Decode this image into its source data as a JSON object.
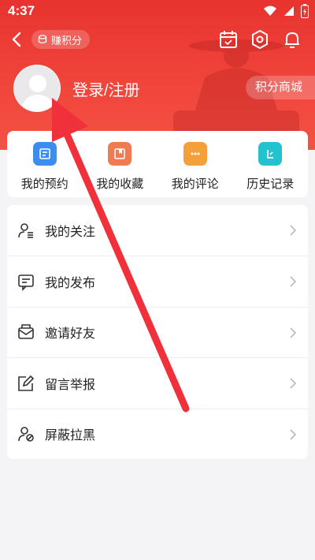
{
  "status": {
    "time": "4:37"
  },
  "nav": {
    "earn_points_label": "赚积分"
  },
  "profile": {
    "login_label": "登录/注册",
    "points_mall_label": "积分商城"
  },
  "quick_actions": [
    {
      "label": "我的预约",
      "icon": "appointment-icon",
      "color": "#3c8df0"
    },
    {
      "label": "我的收藏",
      "icon": "favorites-icon",
      "color": "#f07b52"
    },
    {
      "label": "我的评论",
      "icon": "comments-icon",
      "color": "#f4a03a"
    },
    {
      "label": "历史记录",
      "icon": "history-icon",
      "color": "#23c2cf"
    }
  ],
  "menu": [
    {
      "label": "我的关注",
      "icon": "following-icon"
    },
    {
      "label": "我的发布",
      "icon": "posts-icon"
    },
    {
      "label": "邀请好友",
      "icon": "invite-icon"
    },
    {
      "label": "留言举报",
      "icon": "report-icon"
    },
    {
      "label": "屏蔽拉黑",
      "icon": "block-icon"
    }
  ],
  "colors": {
    "brand_red": "#e8332f",
    "annotation_arrow": "#f0303a"
  }
}
